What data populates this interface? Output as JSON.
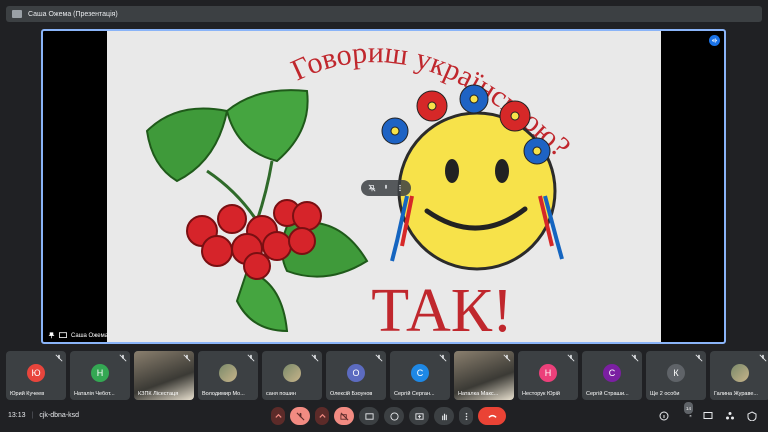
{
  "window": {
    "tab_title": "Саша Ожема (Презентація)"
  },
  "slide": {
    "title_line": "Говориш українською?",
    "answer": "ТАК!",
    "colors": {
      "text_red": "#c0272d",
      "face_yellow": "#f7e24a",
      "berry_red": "#d6242a",
      "leaf_green": "#3f9a3a"
    }
  },
  "stage": {
    "presenter_name": "Саша Ожема"
  },
  "participants": [
    {
      "name": "Юрий Кучеев",
      "initial": "Ю",
      "color": "#e8453c",
      "type": "avatar"
    },
    {
      "name": "Наталія Чебот...",
      "initial": "Н",
      "color": "#34a853",
      "type": "avatar"
    },
    {
      "name": "КЗПК Лісестаця",
      "initial": "",
      "color": "",
      "type": "video"
    },
    {
      "name": "Володимир Мо...",
      "initial": "",
      "color": "",
      "type": "photo"
    },
    {
      "name": "саня пошин",
      "initial": "",
      "color": "",
      "type": "photo"
    },
    {
      "name": "Олексій Бзоунов",
      "initial": "О",
      "color": "#5c6bc0",
      "type": "avatar"
    },
    {
      "name": "Сергій Серган...",
      "initial": "С",
      "color": "#1e88e5",
      "type": "avatar"
    },
    {
      "name": "Наталка Макс...",
      "initial": "",
      "color": "",
      "type": "video"
    },
    {
      "name": "Несторук Юрій",
      "initial": "Н",
      "color": "#ec407a",
      "type": "avatar"
    },
    {
      "name": "Сергій Страши...",
      "initial": "С",
      "color": "#7b1fa2",
      "type": "avatar"
    },
    {
      "name": "Ще 2 особи",
      "initial": "К",
      "color": "#5f6368",
      "type": "more"
    },
    {
      "name": "Галина Жураве...",
      "initial": "",
      "color": "",
      "type": "photo"
    }
  ],
  "bottombar": {
    "time": "13:13",
    "meeting_code": "cjk-dbna-ksd",
    "people_count": "14"
  }
}
